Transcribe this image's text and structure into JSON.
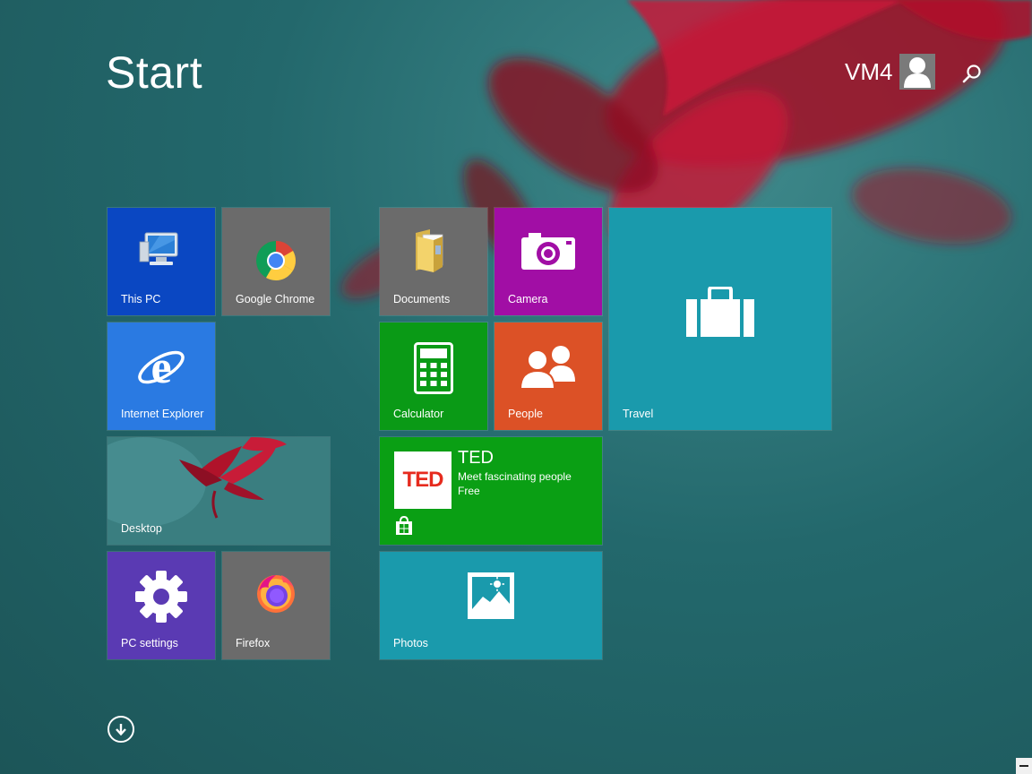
{
  "screen": {
    "title": "Start",
    "colors": {
      "bg": "#23686c",
      "flower": "#b0132a"
    }
  },
  "user": {
    "name": "VM4",
    "avatar_icon": "user-silhouette-icon"
  },
  "search": {
    "icon": "magnifier-icon"
  },
  "tiles": [
    {
      "label": "This PC",
      "color": "#0a47c2",
      "icon": "computer-icon"
    },
    {
      "label": "Google Chrome",
      "color": "#6b6b6b",
      "icon": "chrome-icon"
    },
    {
      "label": "Internet Explorer",
      "color": "#2a7ae2",
      "icon": "internet-explorer-icon"
    },
    {
      "label": "Desktop",
      "icon": "desktop-wallpaper-preview"
    },
    {
      "label": "PC settings",
      "color": "#5a3ab3",
      "icon": "gear-icon"
    },
    {
      "label": "Firefox",
      "color": "#6b6b6b",
      "icon": "firefox-icon"
    },
    {
      "label": "Documents",
      "color": "#6b6b6b",
      "icon": "folder-icon"
    },
    {
      "label": "Camera",
      "color": "#a10ea5",
      "icon": "camera-icon"
    },
    {
      "label": "Calculator",
      "color": "#0a9a16",
      "icon": "calculator-icon"
    },
    {
      "label": "People",
      "color": "#dc5126",
      "icon": "people-icon"
    },
    {
      "label": "Travel",
      "color": "#1a9aac",
      "icon": "suitcase-icon"
    },
    {
      "label": "Photos",
      "color": "#1a9aac",
      "icon": "photo-icon"
    }
  ],
  "ted": {
    "logo": "TED",
    "title": "TED",
    "description": "Meet fascinating people",
    "price": "Free",
    "color": "#0a9f14",
    "store_icon": "store-icon"
  },
  "down_button": {
    "icon": "arrow-down-circle-icon"
  }
}
